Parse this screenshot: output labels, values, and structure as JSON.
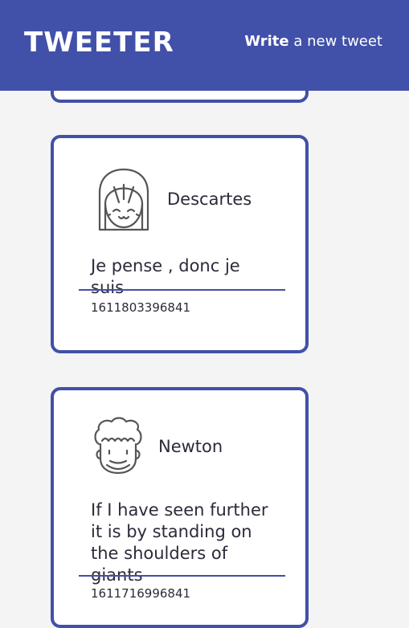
{
  "nav": {
    "brand": "TWEETER",
    "compose_strong": "Write",
    "compose_rest": " a new tweet"
  },
  "tweets": [
    {
      "author": "Descartes",
      "avatar_icon": "girl-face-icon",
      "text": "Je pense , donc je suis",
      "timestamp": "1611803396841"
    },
    {
      "author": "Newton",
      "avatar_icon": "curly-hair-face-icon",
      "text": "If I have seen further it is by standing on the shoulders of giants",
      "timestamp": "1611716996841"
    }
  ],
  "colors": {
    "accent": "#4150a8",
    "background": "#f4f4f4",
    "card": "#ffffff",
    "text": "#2b2b3a"
  }
}
